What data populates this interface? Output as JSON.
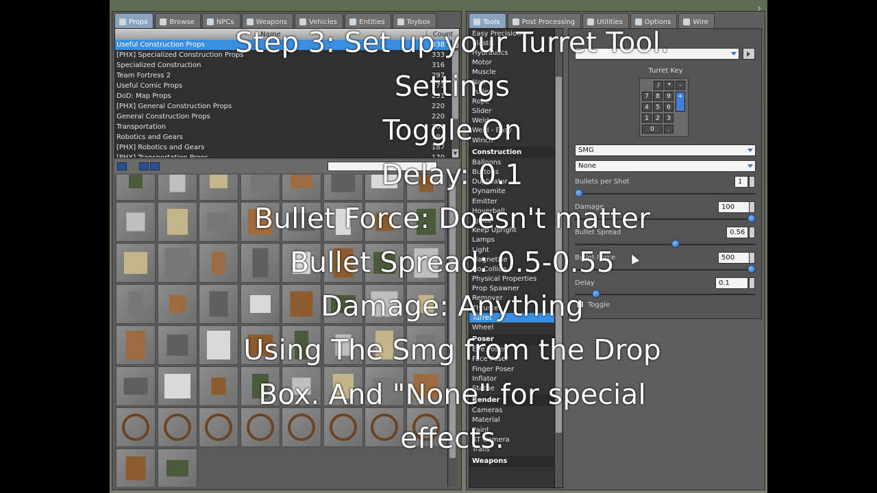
{
  "spawnmenu": {
    "tabs": [
      {
        "label": "Props",
        "active": true
      },
      {
        "label": "Browse"
      },
      {
        "label": "NPCs"
      },
      {
        "label": "Weapons"
      },
      {
        "label": "Vehicles"
      },
      {
        "label": "Entities"
      },
      {
        "label": "Toybox"
      }
    ],
    "list": {
      "header_name": "Name",
      "header_count": "Count",
      "rows": [
        {
          "name": "Useful Construction Props",
          "count": "338"
        },
        {
          "name": "[PHX] Specialized Construction Props",
          "count": "333"
        },
        {
          "name": "Specialized Construction",
          "count": "316"
        },
        {
          "name": "Team Fortress 2",
          "count": "297"
        },
        {
          "name": "Useful Comic Props",
          "count": "271"
        },
        {
          "name": "DoD: Map Props",
          "count": "251"
        },
        {
          "name": "[PHX] General Construction Props",
          "count": "220"
        },
        {
          "name": "General Construction Props",
          "count": "220"
        },
        {
          "name": "Transportation",
          "count": "200"
        },
        {
          "name": "Robotics and Gears",
          "count": "188"
        },
        {
          "name": "[PHX] Robotics and Gears",
          "count": "187"
        },
        {
          "name": "[PHX] Transportation Props",
          "count": "170"
        }
      ]
    }
  },
  "context": {
    "tabs": [
      {
        "label": "Tools",
        "active": true
      },
      {
        "label": "Post Processing"
      },
      {
        "label": "Utilities"
      },
      {
        "label": "Options"
      },
      {
        "label": "Wire"
      }
    ],
    "tools": [
      {
        "label": "Easy Precision"
      },
      {
        "label": "Elastic"
      },
      {
        "label": "Hydraulics"
      },
      {
        "label": "Motor"
      },
      {
        "label": "Muscle"
      },
      {
        "label": "Nail"
      },
      {
        "label": "Pulley"
      },
      {
        "label": "Rope"
      },
      {
        "label": "Slider"
      },
      {
        "label": "Weld"
      },
      {
        "label": "Weld - Easy"
      },
      {
        "label": "Winch"
      },
      {
        "label": "Construction",
        "header": true
      },
      {
        "label": "Balloons"
      },
      {
        "label": "Buttons"
      },
      {
        "label": "Duplicator"
      },
      {
        "label": "Dynamite"
      },
      {
        "label": "Emitter"
      },
      {
        "label": "Hoverball"
      },
      {
        "label": "Ignite"
      },
      {
        "label": "Keep Upright"
      },
      {
        "label": "Lamps"
      },
      {
        "label": "Light"
      },
      {
        "label": "Magnetise"
      },
      {
        "label": "No Collide"
      },
      {
        "label": "Physical Properties"
      },
      {
        "label": "Prop Spawner"
      },
      {
        "label": "Remover"
      },
      {
        "label": "Thruster"
      },
      {
        "label": "Turret",
        "selected": true
      },
      {
        "label": "Wheel"
      },
      {
        "label": "Poser",
        "header": true
      },
      {
        "label": "Eye Poser"
      },
      {
        "label": "Face Poser"
      },
      {
        "label": "Finger Poser"
      },
      {
        "label": "Inflator"
      },
      {
        "label": "Statue"
      },
      {
        "label": "Render",
        "header": true
      },
      {
        "label": "Cameras"
      },
      {
        "label": "Material"
      },
      {
        "label": "Paint"
      },
      {
        "label": "RT Camera"
      },
      {
        "label": "Trails"
      },
      {
        "label": "Weapons",
        "header": true
      }
    ],
    "settings": {
      "turret_key_label": "Turret Key",
      "keypad": [
        "/",
        "*",
        "-",
        "7",
        "8",
        "9",
        "4",
        "5",
        "6",
        "1",
        "2",
        "3",
        "0",
        ".",
        "+"
      ],
      "weapon_select": "SMG",
      "effect_select": "None",
      "bullets_label": "Bullets per Shot",
      "bullets_value": "1",
      "damage_label": "Damage",
      "damage_value": "100",
      "spread_label": "Bullet Spread",
      "spread_value": "0.56",
      "force_label": "Bullet Force",
      "force_value": "500",
      "delay_label": "Delay",
      "delay_value": "0.1",
      "toggle_label": "Toggle",
      "toggle_checked": true,
      "bullets_level": 0.0,
      "damage_level": 1.0,
      "spread_level": 0.56,
      "force_level": 1.0,
      "delay_level": 0.1
    }
  },
  "overlay": {
    "lines": [
      "Step 3: Set up your Turret Tool.",
      "Settings",
      "Toggle On",
      "Delay: 0.1",
      "Bullet Force: Doesn't matter",
      "Bullet Spread: 0.5-0.55",
      "Damage: Anything",
      "Using The Smg from the Drop",
      "Box. And \"None\" for special",
      "effects."
    ]
  },
  "colors": {
    "selection": "#3b8fe0",
    "slider_knob": "#2a68b5"
  }
}
